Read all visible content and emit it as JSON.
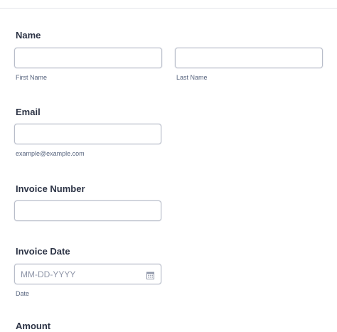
{
  "form": {
    "name": {
      "label": "Name",
      "first_sublabel": "First Name",
      "last_sublabel": "Last Name",
      "first_value": "",
      "last_value": ""
    },
    "email": {
      "label": "Email",
      "sublabel": "example@example.com",
      "value": ""
    },
    "invoice_number": {
      "label": "Invoice Number",
      "value": ""
    },
    "invoice_date": {
      "label": "Invoice Date",
      "placeholder": "MM-DD-YYYY",
      "sublabel": "Date",
      "icon": "calendar-icon",
      "value": ""
    },
    "next_field": {
      "label": "Amount"
    }
  },
  "colors": {
    "label_text": "#2c3345",
    "sublabel_text": "#57647e",
    "input_border": "#b8bdc9",
    "placeholder_text": "#8f96a8",
    "divider": "#e3e5ea"
  }
}
